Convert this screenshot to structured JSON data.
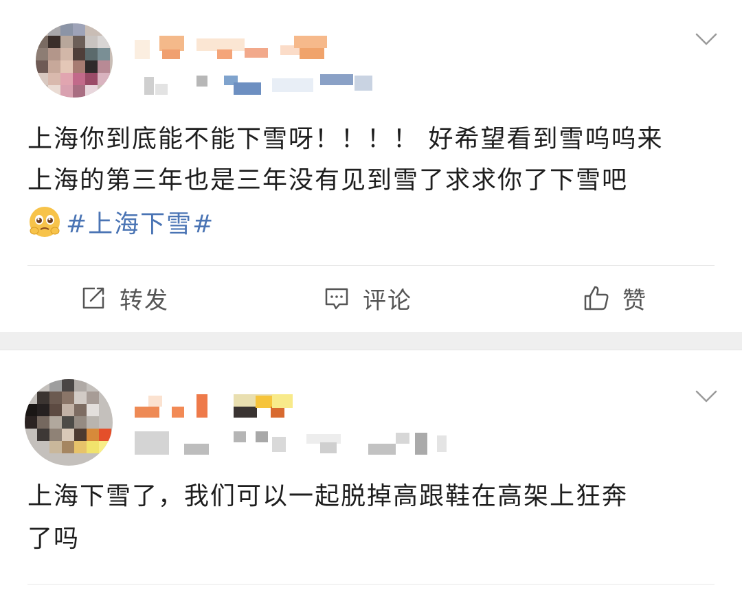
{
  "posts": [
    {
      "text_line1": "上海你到底能不能下雪呀！！！！ 好希望看到雪呜呜来",
      "text_line2": "上海的第三年也是三年没有见到雪了求求你了下雪吧",
      "emoji": "pleading-face-emoji",
      "topic": "#上海下雪#",
      "actions": {
        "repost_label": "转发",
        "comment_label": "评论",
        "like_label": "赞"
      }
    },
    {
      "text_line1": "上海下雪了，我们可以一起脱掉高跟鞋在高架上狂奔",
      "text_line2": "了吗"
    }
  ],
  "colors": {
    "topic_link": "#4a74b4",
    "separator": "#efefef",
    "icon_gray": "#666666"
  },
  "icons": [
    "chevron-down-icon",
    "repost-icon",
    "comment-icon",
    "like-icon"
  ]
}
